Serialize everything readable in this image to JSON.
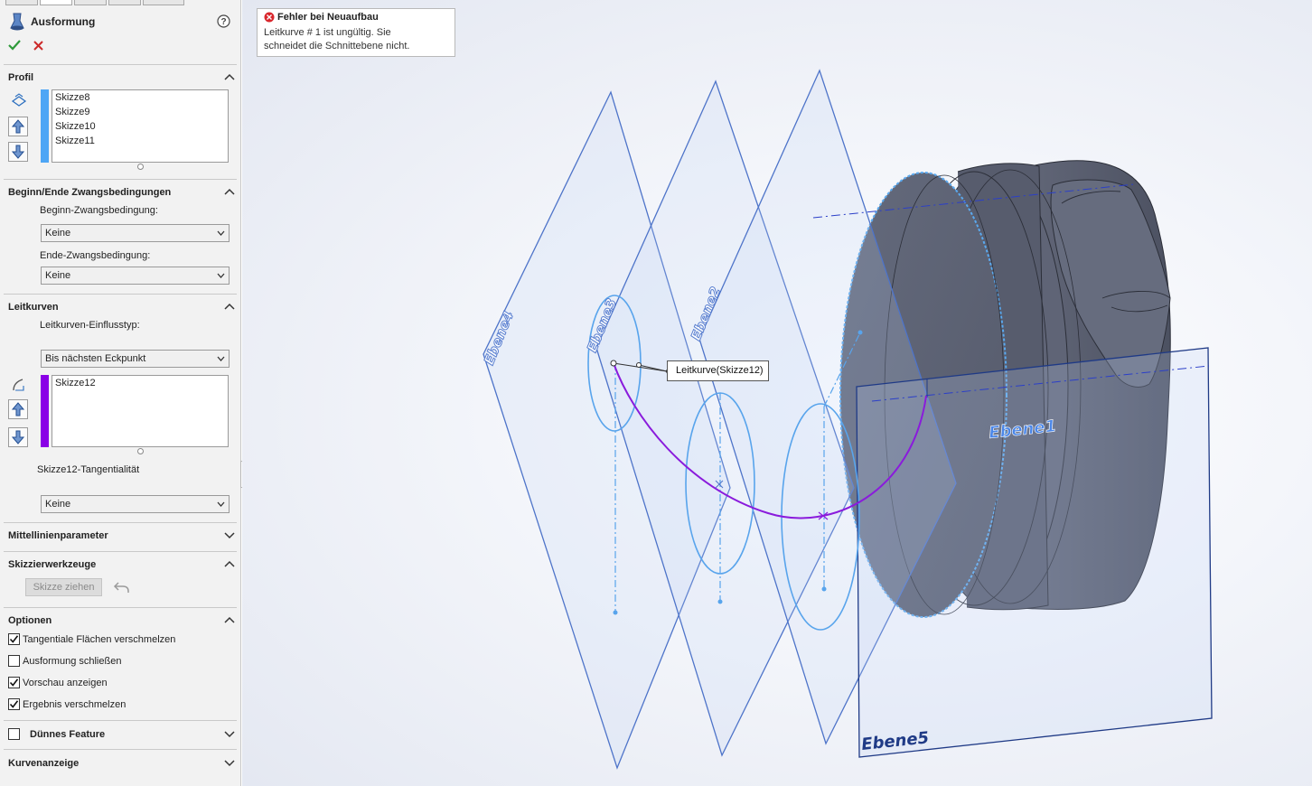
{
  "feature": {
    "title": "Ausformung",
    "help_icon": "help-icon",
    "ok_icon": "checkmark-icon",
    "cancel_icon": "close-icon"
  },
  "colors": {
    "profile_bar": "#4ea6f5",
    "guide_bar": "#8a00e6",
    "guide_curve": "#8a1bdc",
    "plane_edge": "#3f67c4",
    "model": "#5b6072",
    "error": "#d9262c"
  },
  "profile": {
    "label": "Profil",
    "items": [
      "Skizze8",
      "Skizze9",
      "Skizze10",
      "Skizze11"
    ]
  },
  "constraints": {
    "label": "Beginn/Ende Zwangsbedingungen",
    "start_label": "Beginn-Zwangsbedingung:",
    "start_value": "Keine",
    "end_label": "Ende-Zwangsbedingung:",
    "end_value": "Keine"
  },
  "guides": {
    "label": "Leitkurven",
    "influence_label": "Leitkurven-Einflusstyp:",
    "influence_value": "Bis nächsten Eckpunkt",
    "items": [
      "Skizze12"
    ],
    "tangency_label": "Skizze12-Tangentialität",
    "tangency_value": "Keine"
  },
  "centerline": {
    "label": "Mittellinienparameter"
  },
  "sketch_tools": {
    "label": "Skizzierwerkzeuge",
    "drag_button": "Skizze ziehen"
  },
  "options": {
    "label": "Optionen",
    "items": [
      {
        "label": "Tangentiale Flächen verschmelzen",
        "checked": true
      },
      {
        "label": "Ausformung schließen",
        "checked": false
      },
      {
        "label": "Vorschau anzeigen",
        "checked": true
      },
      {
        "label": "Ergebnis verschmelzen",
        "checked": true
      }
    ]
  },
  "thin_feature": {
    "label": "Dünnes Feature",
    "checked": false
  },
  "curve_display": {
    "label": "Kurvenanzeige"
  },
  "error_tooltip": {
    "title": "Fehler bei Neuaufbau",
    "line1": "Leitkurve # 1 ist ungültig. Sie",
    "line2": "schneidet die Schnittebene nicht."
  },
  "viewport": {
    "callout": "Leitkurve(Skizze12)",
    "planes": [
      "Ebene4",
      "Ebene3",
      "Ebene2",
      "Ebene1",
      "Ebene5"
    ]
  }
}
